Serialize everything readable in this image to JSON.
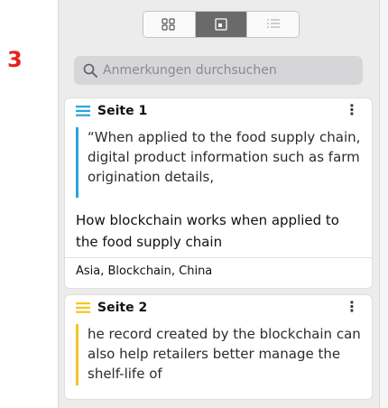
{
  "step_number": "3",
  "view_switcher": {
    "buttons": [
      {
        "icon": "grid-view-icon",
        "active": false
      },
      {
        "icon": "page-view-icon",
        "active": true
      },
      {
        "icon": "list-view-icon",
        "active": false
      }
    ]
  },
  "search": {
    "placeholder": "Anmerkungen durchsuchen",
    "value": ""
  },
  "annotations": [
    {
      "page_label": "Seite 1",
      "color": "#2aa4e0",
      "quote": "“When applied to the food supply chain, digital product information such as farm origination details,",
      "note": "How blockchain works when applied to the food supply chain",
      "tags": "Asia, Blockchain, China",
      "menu_glyph": "⋮"
    },
    {
      "page_label": "Seite 2",
      "color": "#f3c623",
      "quote": "he record created by the blockchain can also help retailers better manage the shelf-life of",
      "menu_glyph": "⋮"
    }
  ]
}
